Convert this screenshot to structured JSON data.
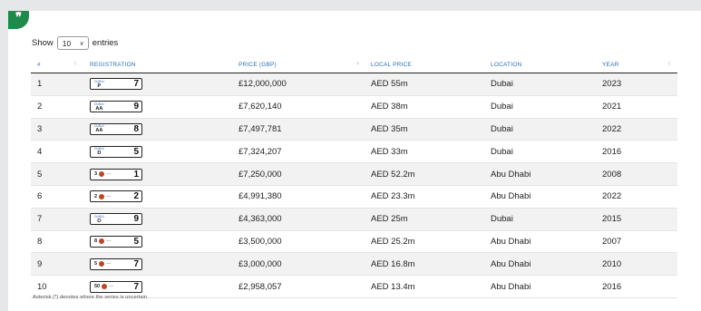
{
  "badge": {
    "icon": "quote-icon",
    "glyph": "❞"
  },
  "length_control": {
    "prefix": "Show",
    "value": "10",
    "suffix": "entries"
  },
  "table": {
    "headers": [
      "#",
      "REGISTRATION",
      "PRICE (GBP)",
      "LOCAL PRICE",
      "LOCATION",
      "YEAR"
    ],
    "rows": [
      {
        "rank": "1",
        "plate": {
          "style": "dubai",
          "emirate": "DUBAI",
          "series": "P",
          "number": "7"
        },
        "price": "£12,000,000",
        "local": "AED 55m",
        "location": "Dubai",
        "year": "2023"
      },
      {
        "rank": "2",
        "plate": {
          "style": "dubai",
          "emirate": "DUBAI",
          "series": "AA",
          "number": "9"
        },
        "price": "£7,620,140",
        "local": "AED 38m",
        "location": "Dubai",
        "year": "2021"
      },
      {
        "rank": "3",
        "plate": {
          "style": "dubai",
          "emirate": "DUBAI",
          "series": "AA",
          "number": "8"
        },
        "price": "£7,497,781",
        "local": "AED 35m",
        "location": "Dubai",
        "year": "2022"
      },
      {
        "rank": "4",
        "plate": {
          "style": "dubai",
          "emirate": "DUBAI",
          "series": "D",
          "number": "5"
        },
        "price": "£7,324,207",
        "local": "AED 33m",
        "location": "Dubai",
        "year": "2016"
      },
      {
        "rank": "5",
        "plate": {
          "style": "abudhabi",
          "series": "3",
          "number": "1"
        },
        "price": "£7,250,000",
        "local": "AED 52.2m",
        "location": "Abu Dhabi",
        "year": "2008"
      },
      {
        "rank": "6",
        "plate": {
          "style": "abudhabi",
          "series": "2",
          "number": "2"
        },
        "price": "£4,991,380",
        "local": "AED 23.3m",
        "location": "Abu Dhabi",
        "year": "2022"
      },
      {
        "rank": "7",
        "plate": {
          "style": "dubai",
          "emirate": "DUBAI",
          "series": "O",
          "number": "9"
        },
        "price": "£4,363,000",
        "local": "AED 25m",
        "location": "Dubai",
        "year": "2015"
      },
      {
        "rank": "8",
        "plate": {
          "style": "abudhabi",
          "series": "8",
          "number": "5"
        },
        "price": "£3,500,000",
        "local": "AED 25.2m",
        "location": "Abu Dhabi",
        "year": "2007"
      },
      {
        "rank": "9",
        "plate": {
          "style": "abudhabi",
          "series": "5",
          "number": "7"
        },
        "price": "£3,000,000",
        "local": "AED 16.8m",
        "location": "Abu Dhabi",
        "year": "2010"
      },
      {
        "rank": "10",
        "plate": {
          "style": "abudhabi",
          "series": "50",
          "number": "7"
        },
        "price": "£2,958,057",
        "local": "AED 13.4m",
        "location": "Abu Dhabi",
        "year": "2016"
      }
    ]
  },
  "footnote": "Asterisk (*) denotes where the series is uncertain.",
  "colors": {
    "accent": "#2d6db5",
    "badge": "#1f8a4c"
  }
}
